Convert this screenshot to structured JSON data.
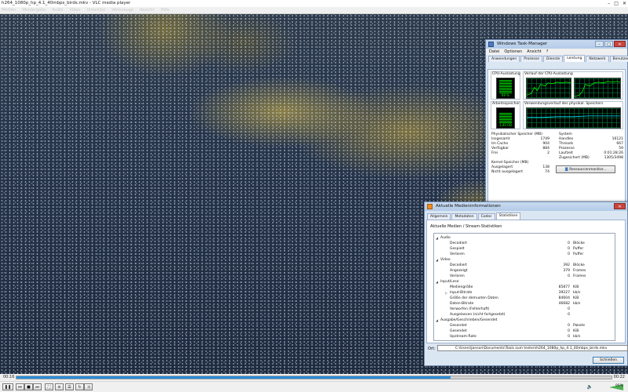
{
  "vlc": {
    "title": "h264_1080p_hp_4.1_40mbps_birds.mkv - VLC media player",
    "menu": [
      "Medien",
      "Wiedergabe",
      "Audio",
      "Video",
      "Untertitel",
      "Werkzeuge",
      "Ansicht",
      "Hilfe"
    ],
    "time_elapsed": "00:16",
    "time_total": "00:22",
    "progress_fraction": 0.73,
    "volume": "95%"
  },
  "task_manager": {
    "title": "Windows Task-Manager",
    "menu": [
      "Datei",
      "Optionen",
      "Ansicht",
      "?"
    ],
    "tabs": [
      "Anwendungen",
      "Prozesse",
      "Dienste",
      "Leistung",
      "Netzwerk",
      "Benutzer"
    ],
    "active_tab": "Leistung",
    "cpu_label": "CPU-Auslastung",
    "cpu_value": "99 %",
    "cpu_history_label": "Verlauf der CPU-Auslastung",
    "memory_label": "Arbeitsspeicher",
    "memory_value": "1,40 GB",
    "memory_history_label": "Verwendungsverlauf des physikal. Speichers",
    "physical_memory": {
      "header": "Physikalischer Speicher (MB)",
      "rows": [
        {
          "k": "Insgesamt",
          "v": "1749"
        },
        {
          "k": "Im Cache",
          "v": "904"
        },
        {
          "k": "Verfügbar",
          "v": "884"
        },
        {
          "k": "Frei",
          "v": "2"
        }
      ]
    },
    "system": {
      "header": "System",
      "rows": [
        {
          "k": "Handles",
          "v": "16121"
        },
        {
          "k": "Threads",
          "v": "667"
        },
        {
          "k": "Prozesse",
          "v": "59"
        },
        {
          "k": "Laufzeit",
          "v": "0:01:28:26"
        },
        {
          "k": "Zugesichert (MB)",
          "v": "1305/3498"
        }
      ]
    },
    "kernel_memory": {
      "header": "Kernel-Speicher (MB)",
      "rows": [
        {
          "k": "Ausgelagert",
          "v": "138"
        },
        {
          "k": "Nicht ausgelagert",
          "v": "74"
        }
      ]
    },
    "resource_monitor_button": "Ressourcenmonitor...",
    "status": {
      "processes": "Prozesse: 59",
      "cpu": "CPU-Auslastung: 99%",
      "memory": "Physikalischer Speicher: 49"
    }
  },
  "media_info": {
    "title": "Aktuelle Medieninformationen",
    "tabs": [
      "Allgemein",
      "Metadaten",
      "Codec",
      "Statistiken"
    ],
    "active_tab": "Statistiken",
    "heading": "Aktuelle Medien / Stream-Statistiken",
    "rows": [
      {
        "level": 0,
        "name": "Audio",
        "value": "",
        "unit": "",
        "expand": "◢"
      },
      {
        "level": 1,
        "name": "Decodiert",
        "value": "0",
        "unit": "Blöcke",
        "expand": ""
      },
      {
        "level": 1,
        "name": "Gespielt",
        "value": "0",
        "unit": "Puffer",
        "expand": ""
      },
      {
        "level": 1,
        "name": "Verloren",
        "value": "0",
        "unit": "Puffer",
        "expand": ""
      },
      {
        "level": 0,
        "name": "Video",
        "value": "",
        "unit": "",
        "expand": "◢"
      },
      {
        "level": 1,
        "name": "Decodiert",
        "value": "392",
        "unit": "Blöcke",
        "expand": ""
      },
      {
        "level": 1,
        "name": "Angezeigt",
        "value": "379",
        "unit": "Frames",
        "expand": ""
      },
      {
        "level": 1,
        "name": "Verloren",
        "value": "0",
        "unit": "Frames",
        "expand": ""
      },
      {
        "level": 0,
        "name": "Input/Lese",
        "value": "",
        "unit": "",
        "expand": "◢"
      },
      {
        "level": 1,
        "name": "Mediengröße",
        "value": "85877",
        "unit": "KiB",
        "expand": ""
      },
      {
        "level": 1,
        "name": "Input-Bitrate",
        "value": "39227",
        "unit": "kb/s",
        "expand": "▷"
      },
      {
        "level": 1,
        "name": "Größe der demuxten Daten",
        "value": "84604",
        "unit": "KiB",
        "expand": ""
      },
      {
        "level": 1,
        "name": "Daten-Bitrate",
        "value": "46682",
        "unit": "kb/s",
        "expand": ""
      },
      {
        "level": 1,
        "name": "Verworfen (Fehlerhaft)",
        "value": "0",
        "unit": "",
        "expand": ""
      },
      {
        "level": 1,
        "name": "Ausgelassen (nicht fortgesetzt)",
        "value": "0",
        "unit": "",
        "expand": ""
      },
      {
        "level": 0,
        "name": "Ausgabe/Geschrieben/Gesendet",
        "value": "",
        "unit": "",
        "expand": "◢"
      },
      {
        "level": 1,
        "name": "Gesendet",
        "value": "0",
        "unit": "Pakete",
        "expand": ""
      },
      {
        "level": 1,
        "name": "Gesendet",
        "value": "0",
        "unit": "KiB",
        "expand": ""
      },
      {
        "level": 1,
        "name": "Upstream-Rate",
        "value": "0",
        "unit": "kb/s",
        "expand": ""
      }
    ],
    "location_label": "Ort:",
    "location_value": "C:\\Users\\Janson\\Documents\\Tools zum testen\\h264_1080p_hp_4.1_40mbps_birds.mkv",
    "close_button": "Schließen"
  }
}
